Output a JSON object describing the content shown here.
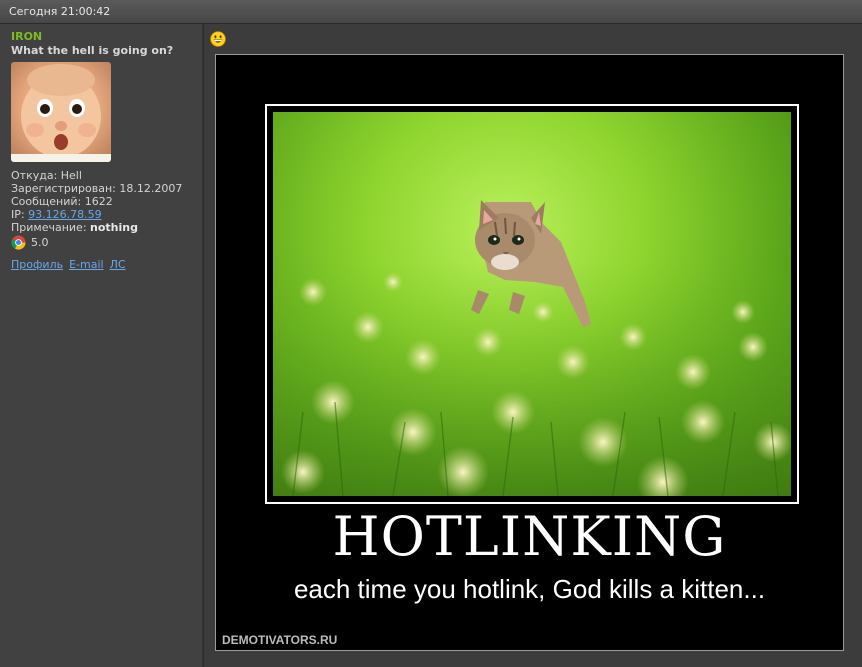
{
  "post": {
    "timestamp": "Сегодня 21:00:42"
  },
  "user": {
    "name": "IRON",
    "title": "What the hell is going on?",
    "from": "Откуда: Hell",
    "registered": "Зарегистрирован: 18.12.2007",
    "messages": "Сообщений: 1622",
    "ip_label": "IP: ",
    "ip": "93.126.78.59",
    "note_label": "Примечание: ",
    "note_value": "nothing",
    "browser_version": "5.0",
    "browser_icon": "chrome-icon",
    "links": {
      "profile": "Профиль",
      "email": "E-mail",
      "pm": "ЛС"
    }
  },
  "content": {
    "smiley_icon": "grin-smiley-icon",
    "poster": {
      "headline": "HOTLINKING",
      "subline": "each time you hotlink, God kills a kitten...",
      "watermark": "DEMOTIVATORS.RU"
    }
  },
  "colors": {
    "username": "#7dbd20",
    "link": "#6aa7e6",
    "sidebar_bg": "#414141",
    "content_bg": "#3c3c3c"
  }
}
